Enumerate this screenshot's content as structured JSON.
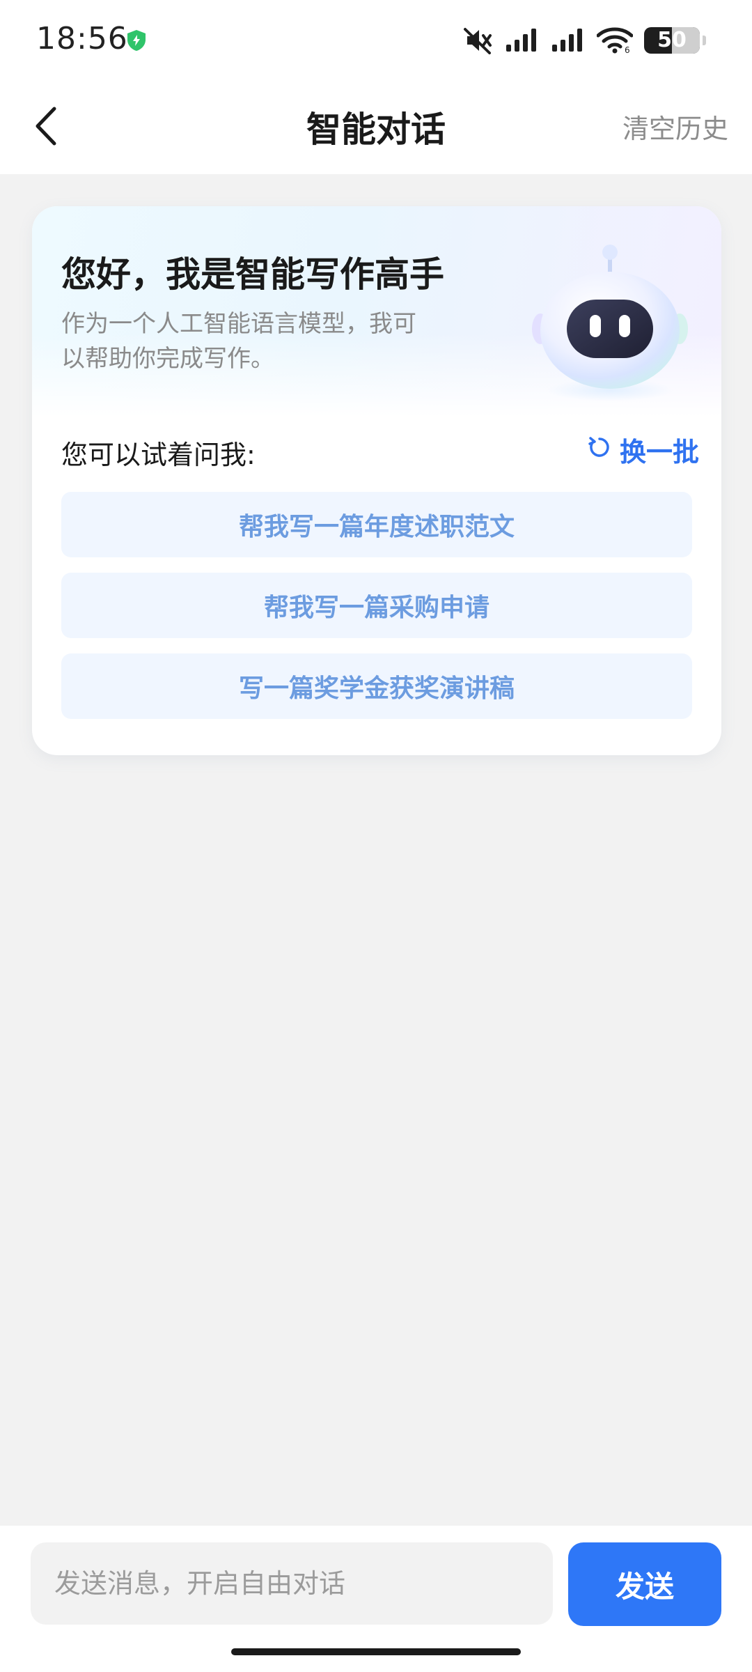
{
  "status_bar": {
    "time": "18:56",
    "battery": {
      "text": "50",
      "level": 0.5
    },
    "icons": [
      "shield-icon",
      "mute-icon",
      "signal-icon",
      "signal-icon",
      "wifi-icon",
      "battery-icon"
    ]
  },
  "header": {
    "title": "智能对话",
    "clear_label": "清空历史",
    "back_icon": "chevron-left-icon"
  },
  "card": {
    "greeting": "您好，我是智能写作高手",
    "intro": "作为一个人工智能语言模型，我可以帮助你完成写作。",
    "prompt_label": "您可以试着问我:",
    "refresh_label": "换一批",
    "refresh_icon": "refresh-icon",
    "avatar_icon": "robot-icon",
    "suggestions": [
      {
        "label": "帮我写一篇年度述职范文"
      },
      {
        "label": "帮我写一篇采购申请"
      },
      {
        "label": "写一篇奖学金获奖演讲稿"
      }
    ]
  },
  "input": {
    "placeholder": "发送消息，开启自由对话",
    "value": "",
    "send_label": "发送"
  },
  "colors": {
    "accent": "#2e77f7",
    "suggestion_text": "#6c9ce0",
    "suggestion_bg": "#f0f6ff",
    "page_bg": "#f2f2f2"
  }
}
